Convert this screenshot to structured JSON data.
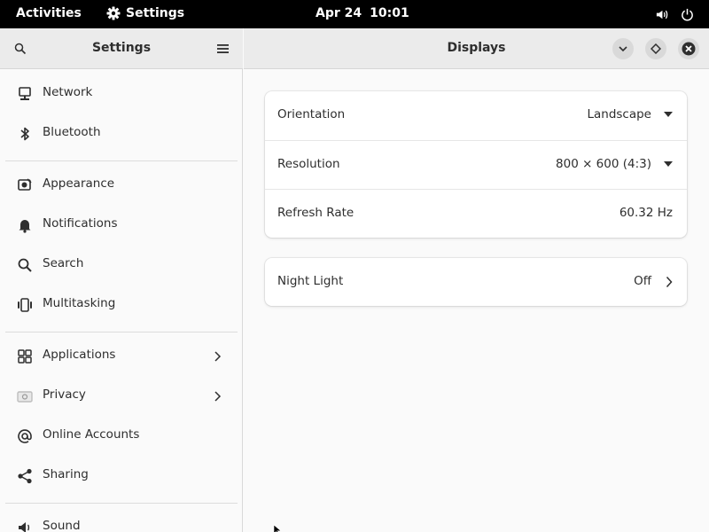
{
  "topbar": {
    "activities": "Activities",
    "app_name": "Settings",
    "date": "Apr 24",
    "time": "10:01"
  },
  "sidebar": {
    "title": "Settings",
    "items": [
      {
        "label": "Network",
        "icon": "network-icon"
      },
      {
        "label": "Bluetooth",
        "icon": "bluetooth-icon"
      },
      {
        "label": "Appearance",
        "icon": "appearance-icon"
      },
      {
        "label": "Notifications",
        "icon": "bell-icon"
      },
      {
        "label": "Search",
        "icon": "search-icon"
      },
      {
        "label": "Multitasking",
        "icon": "multitasking-icon"
      },
      {
        "label": "Applications",
        "icon": "apps-grid-icon"
      },
      {
        "label": "Privacy",
        "icon": "privacy-icon"
      },
      {
        "label": "Online Accounts",
        "icon": "at-icon"
      },
      {
        "label": "Sharing",
        "icon": "share-icon"
      },
      {
        "label": "Sound",
        "icon": "speaker-icon"
      }
    ]
  },
  "main": {
    "title": "Displays",
    "display_card": {
      "orientation_label": "Orientation",
      "orientation_value": "Landscape",
      "resolution_label": "Resolution",
      "resolution_value": "800 × 600 (4:3)",
      "refresh_label": "Refresh Rate",
      "refresh_value": "60.32 Hz"
    },
    "night_light": {
      "label": "Night Light",
      "value": "Off"
    }
  }
}
